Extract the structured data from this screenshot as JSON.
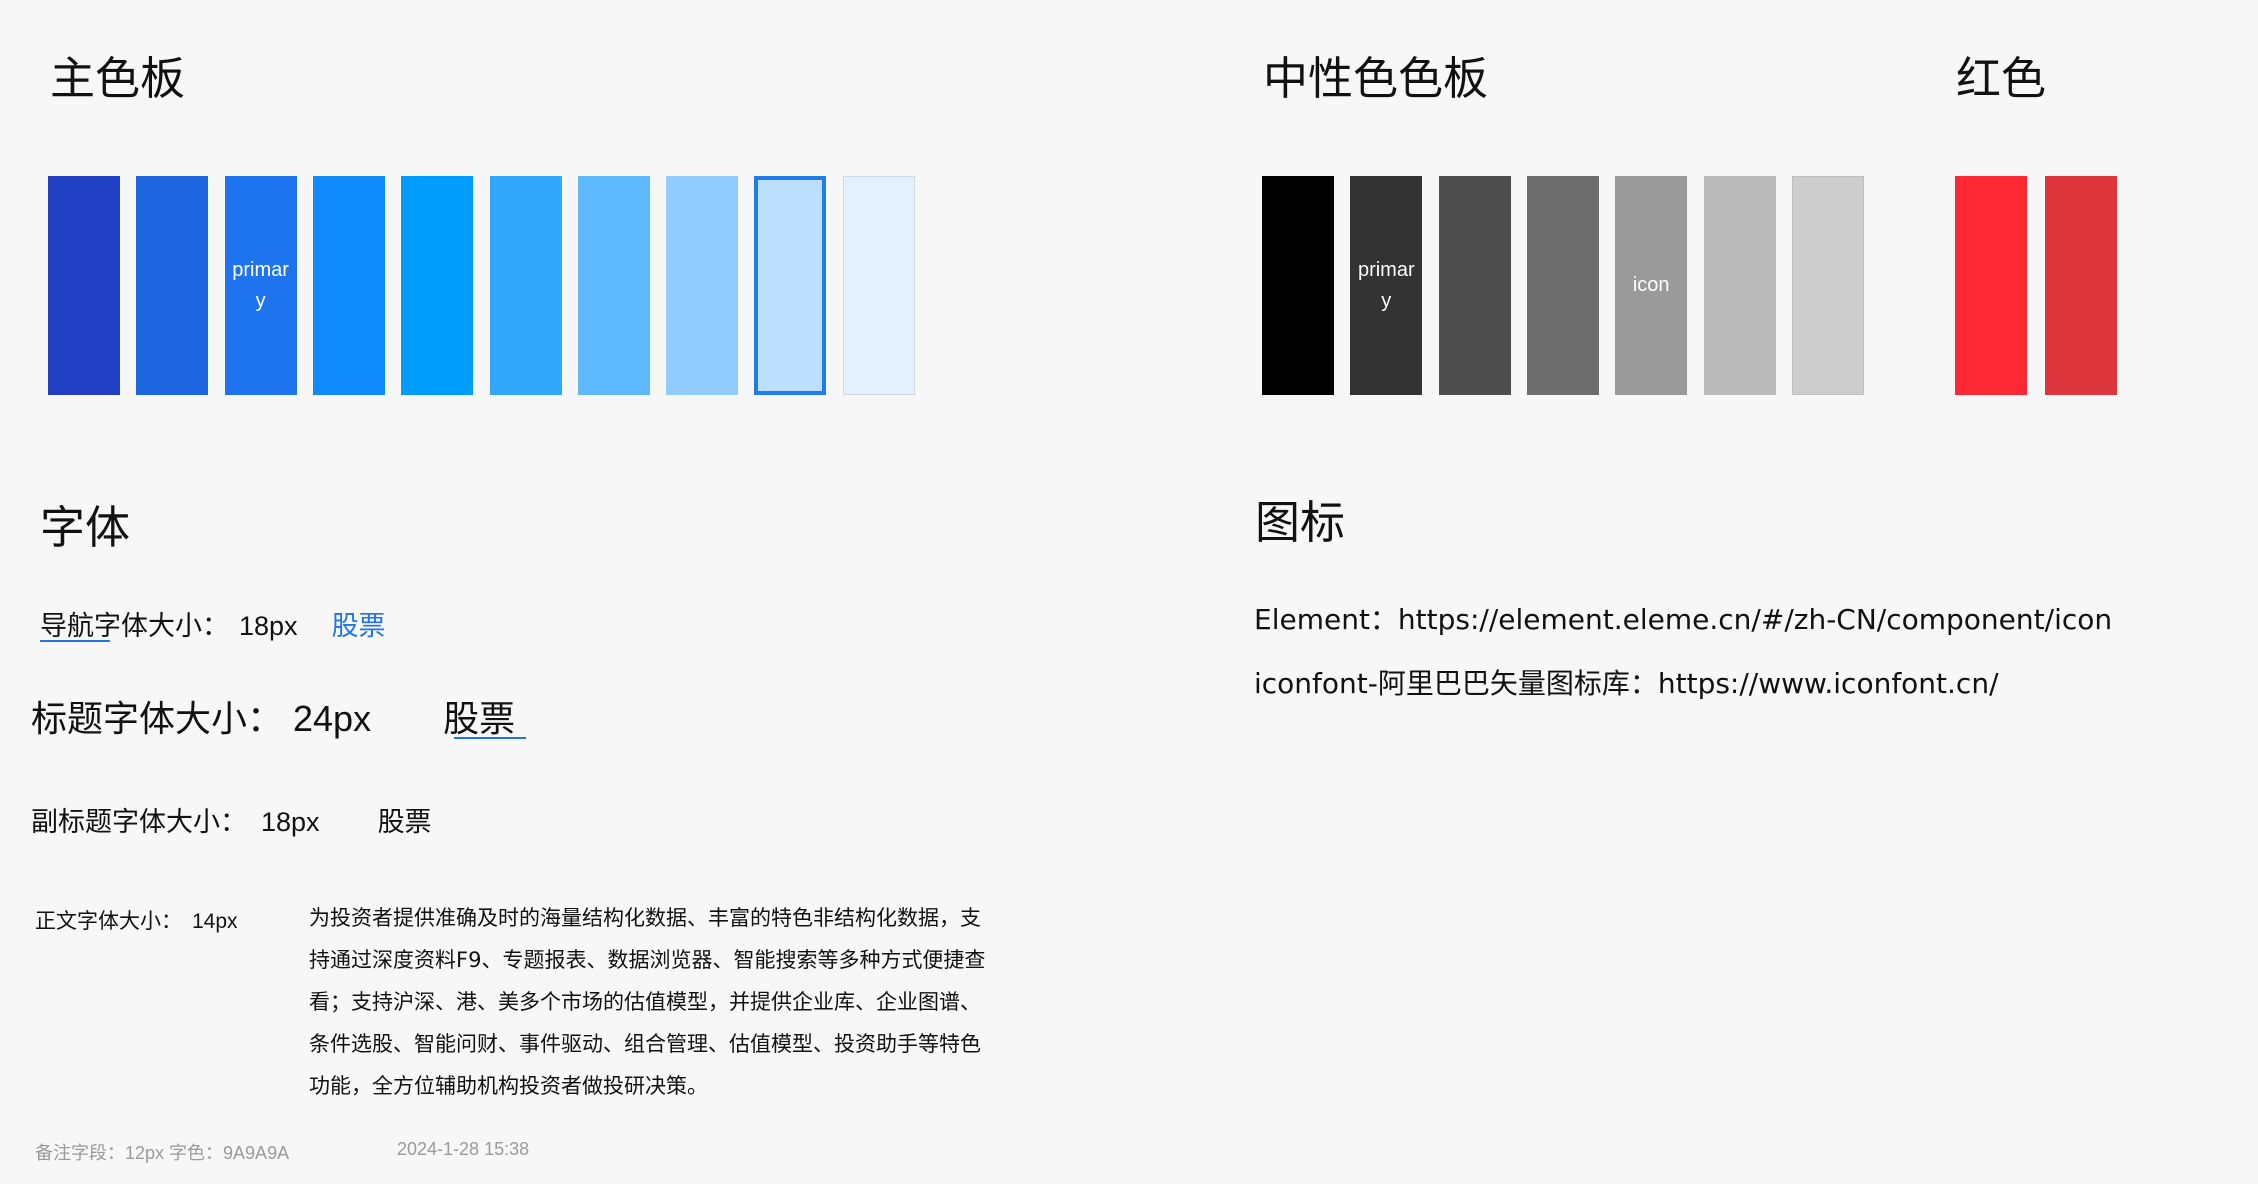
{
  "primary_section": {
    "title": "主色板",
    "swatches": [
      {
        "color": "#2240C4",
        "label": ""
      },
      {
        "color": "#1E65E0",
        "label": ""
      },
      {
        "color": "#1E74EE",
        "label": "primary"
      },
      {
        "color": "#0F8AFA",
        "label": ""
      },
      {
        "color": "#009CFC",
        "label": ""
      },
      {
        "color": "#32A8FD",
        "label": ""
      },
      {
        "color": "#5DB8FD",
        "label": ""
      },
      {
        "color": "#90CCFE",
        "label": ""
      },
      {
        "color": "#BCDFFD",
        "label": ""
      },
      {
        "color": "#E3F1FE",
        "label": ""
      }
    ]
  },
  "neutral_section": {
    "title": "中性色色板",
    "swatches": [
      {
        "color": "#000000",
        "label": ""
      },
      {
        "color": "#333333",
        "label": "primary"
      },
      {
        "color": "#4E4E4E",
        "label": ""
      },
      {
        "color": "#6D6D6D",
        "label": ""
      },
      {
        "color": "#9A9A9A",
        "label": "icon"
      },
      {
        "color": "#BBBBBB",
        "label": ""
      },
      {
        "color": "#CDCDCD",
        "label": ""
      }
    ]
  },
  "red_section": {
    "title": "红色",
    "swatches": [
      {
        "color": "#FC2934",
        "label": ""
      },
      {
        "color": "#DC353B",
        "label": ""
      }
    ]
  },
  "font_section": {
    "title": "字体",
    "nav": {
      "label": "导航字体大小：",
      "size": "18px",
      "sample": "股票",
      "sample_color": "#1F74E8"
    },
    "heading": {
      "label": "标题字体大小：",
      "size": "24px",
      "sample": "股票"
    },
    "subheading": {
      "label": "副标题字体大小：",
      "size": "18px",
      "sample": "股票"
    },
    "body": {
      "label": "正文字体大小：",
      "size": "14px",
      "sample": "为投资者提供准确及时的海量结构化数据、丰富的特色非结构化数据，支持通过深度资料F9、专题报表、数据浏览器、智能搜索等多种方式便捷查看；支持沪深、港、美多个市场的估值模型，并提供企业库、企业图谱、条件选股、智能问财、事件驱动、组合管理、估值模型、投资助手等特色功能，全方位辅助机构投资者做投研决策。"
    },
    "note": {
      "label": "备注字段：12px  字色：9A9A9A",
      "timestamp": "2024-1-28 15:38"
    }
  },
  "icon_section": {
    "title": "图标",
    "links": [
      "Element：https://element.eleme.cn/#/zh-CN/component/icon",
      "iconfont-阿里巴巴矢量图标库：https://www.iconfont.cn/"
    ]
  }
}
